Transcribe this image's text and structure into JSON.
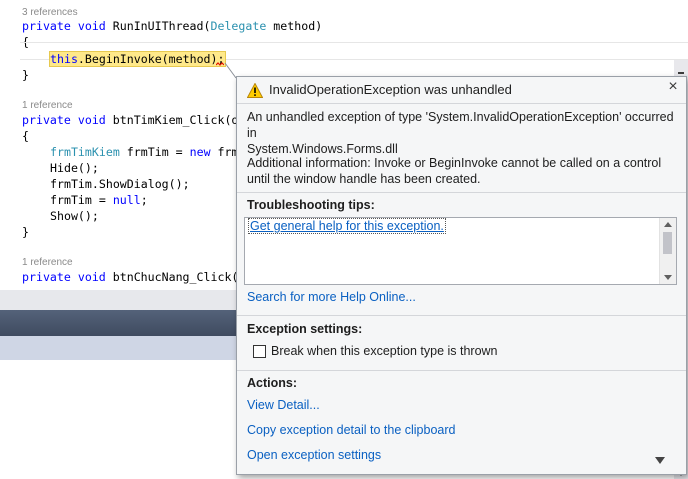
{
  "editor": {
    "lens1": "3 references",
    "line1": {
      "kw1": "private",
      "kw2": "void",
      "name": " RunInUIThread(",
      "type": "Delegate",
      "rest": " method)"
    },
    "brace_open1": "{",
    "line3": {
      "kw": "this",
      "rest": ".BeginInvoke(method);"
    },
    "brace_close1": "}",
    "lens2": "1 reference",
    "line5": {
      "kw1": "private",
      "kw2": "void",
      "rest": " btnTimKiem_Click(o"
    },
    "brace_open2": "{",
    "line7": {
      "type": "frmTimKiem",
      "rest": " frmTim = ",
      "kw": "new",
      "tail": " frm"
    },
    "line8": "Hide();",
    "line9": "frmTim.ShowDialog();",
    "line10": {
      "pre": "frmTim = ",
      "kw": "null",
      "post": ";"
    },
    "line11": "Show();",
    "brace_close2": "}",
    "lens3": "1 reference",
    "line13": {
      "kw1": "private",
      "kw2": "void",
      "rest": " btnChucNang_Click("
    }
  },
  "exception": {
    "title": "InvalidOperationException was unhandled",
    "icon": "warning-icon",
    "message_line1": "An unhandled exception of type 'System.InvalidOperationException' occurred in",
    "message_line2": "System.Windows.Forms.dll",
    "additional_line1": "Additional information: Invoke or BeginInvoke cannot be called on a control",
    "additional_line2": "until the window handle has been created.",
    "tips_heading": "Troubleshooting tips:",
    "tip_link": "Get general help for this exception.",
    "search_link": "Search for more Help Online...",
    "settings_heading": "Exception settings:",
    "break_checkbox_label": "Break when this exception type is thrown",
    "break_checked": false,
    "actions_heading": "Actions:",
    "actions": [
      "View Detail...",
      "Copy exception detail to the clipboard",
      "Open exception settings"
    ]
  },
  "colors": {
    "keyword": "#0000ff",
    "type": "#2b91af",
    "link": "#0a60c2",
    "highlight": "#ffe98a"
  }
}
